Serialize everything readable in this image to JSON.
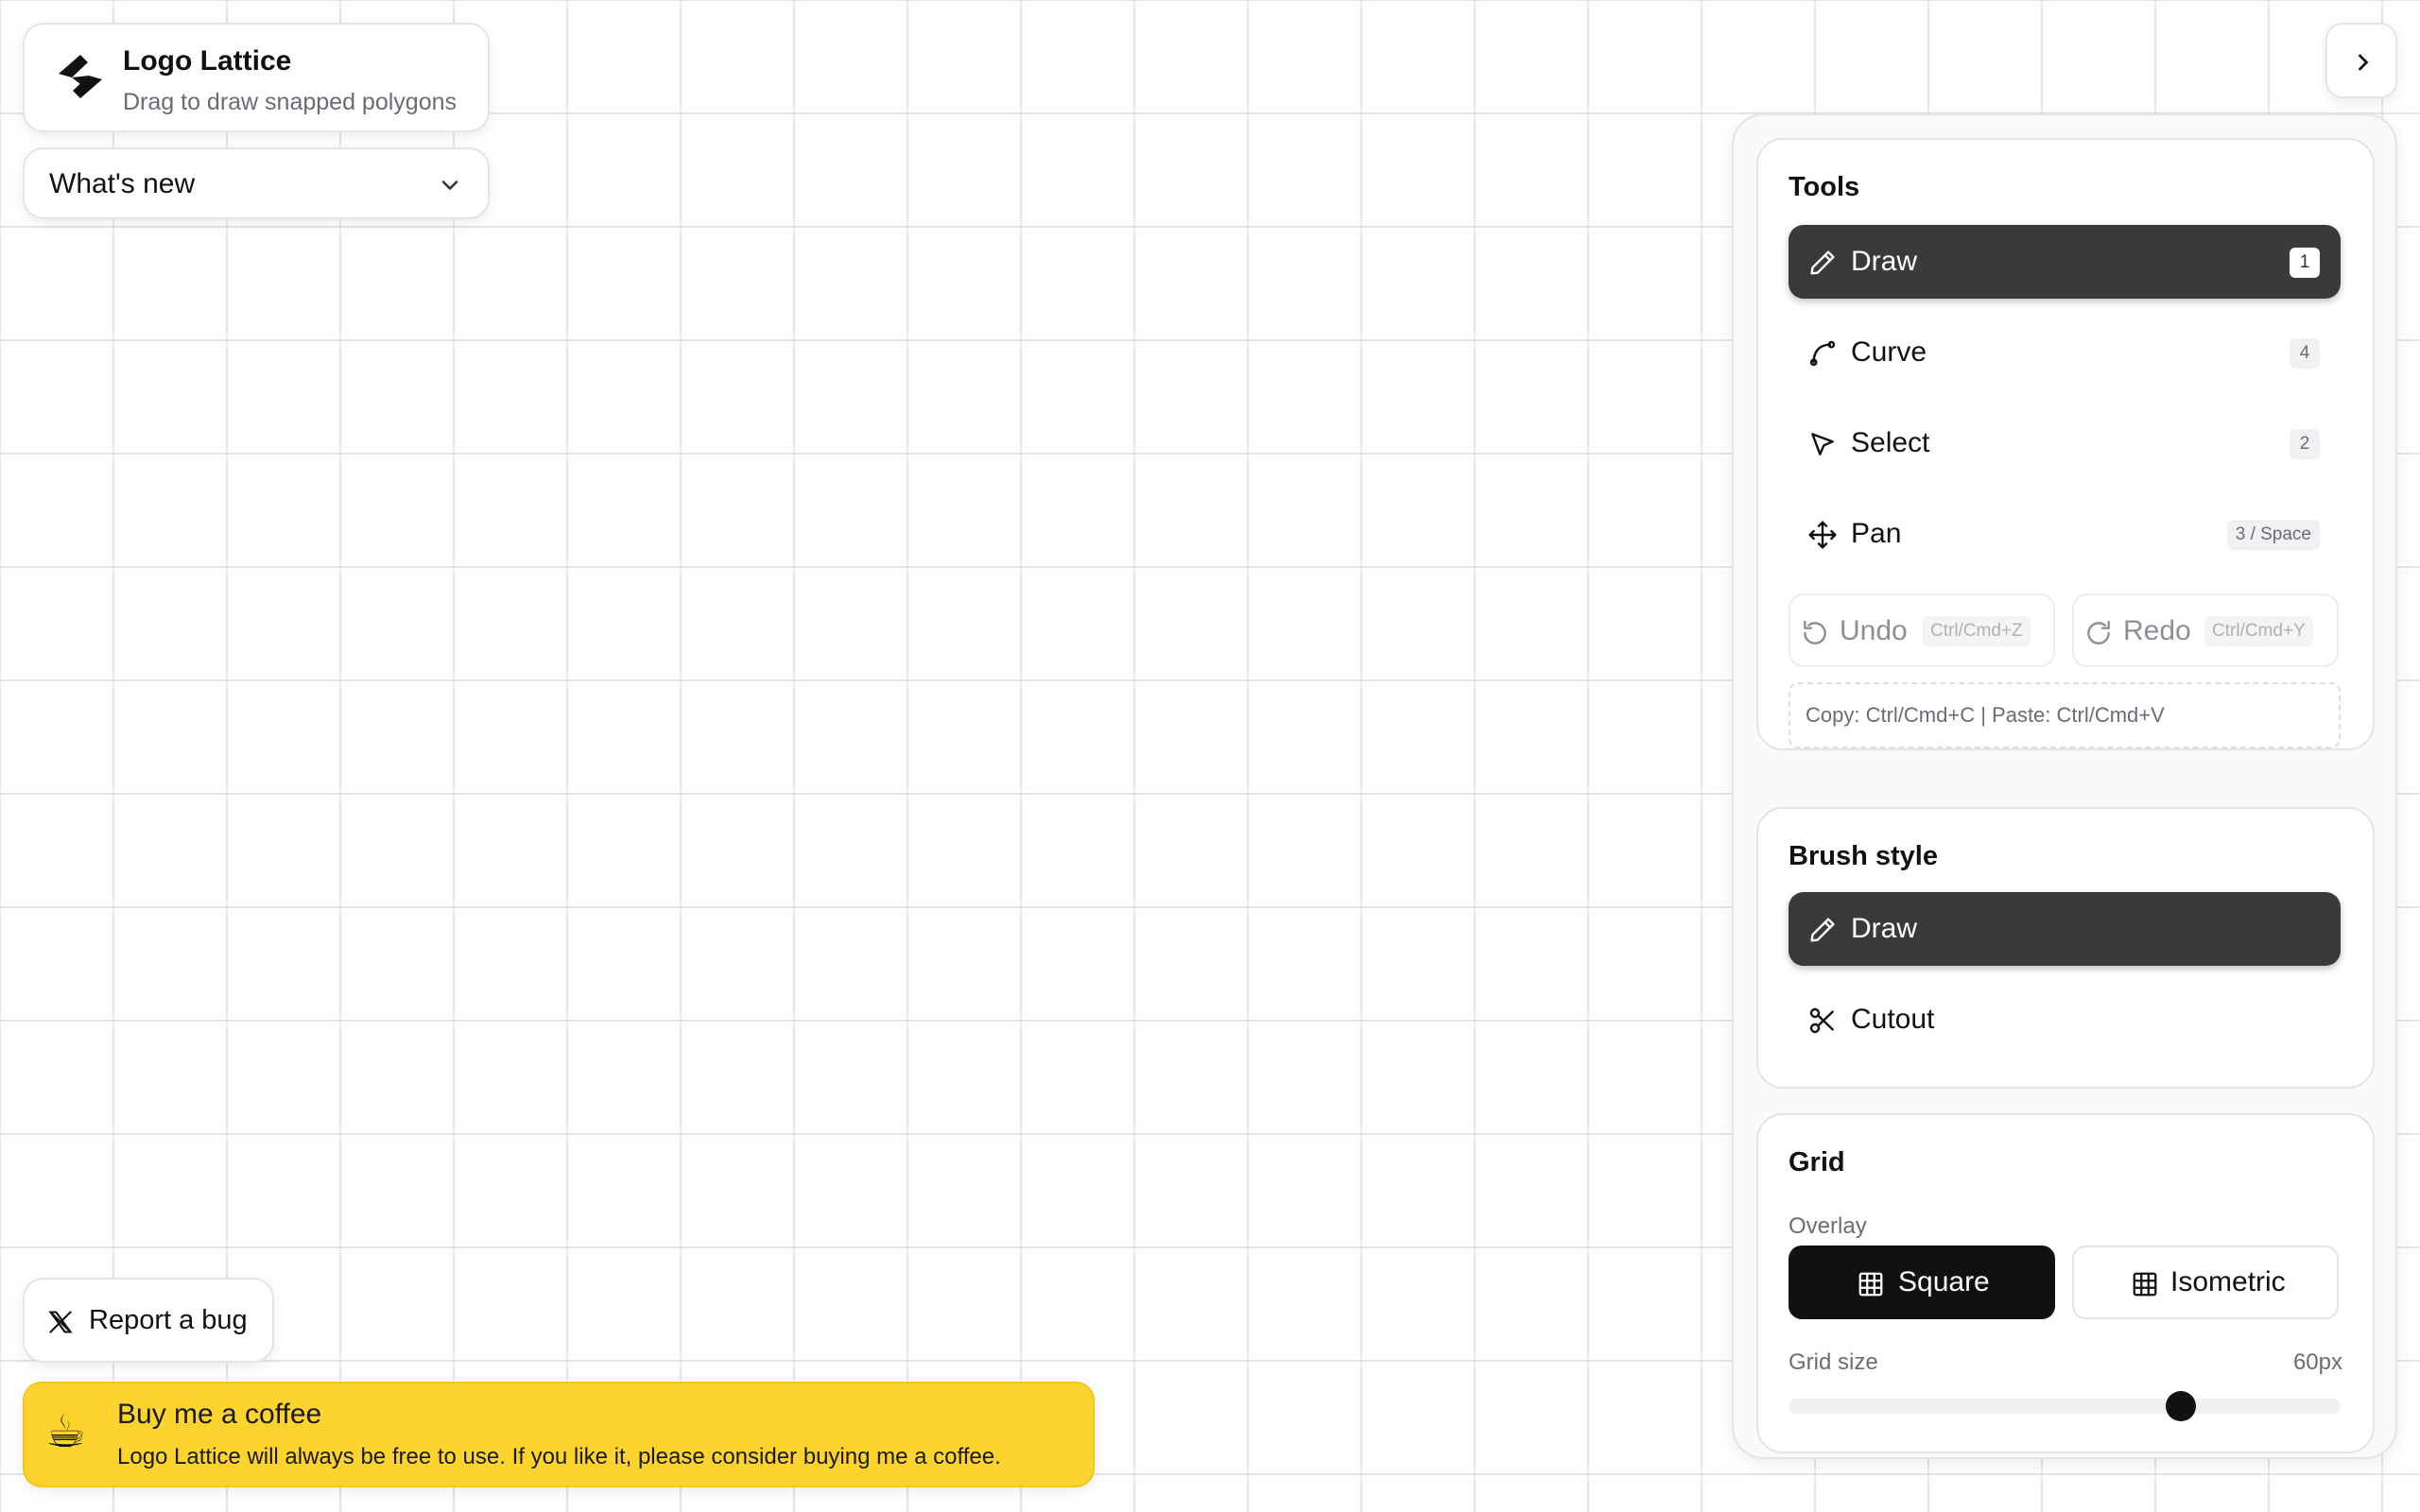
{
  "brand": {
    "title": "Logo Lattice",
    "subtitle": "Drag to draw snapped polygons"
  },
  "whats_new": {
    "label": "What's new"
  },
  "tools": {
    "title": "Tools",
    "items": [
      {
        "label": "Draw",
        "key": "1",
        "icon": "pencil-icon",
        "active": true
      },
      {
        "label": "Curve",
        "key": "4",
        "icon": "curve-icon",
        "active": false
      },
      {
        "label": "Select",
        "key": "2",
        "icon": "cursor-icon",
        "active": false
      },
      {
        "label": "Pan",
        "key": "3 / Space",
        "icon": "move-icon",
        "active": false
      }
    ],
    "undo": {
      "label": "Undo",
      "shortcut": "Ctrl/Cmd+Z"
    },
    "redo": {
      "label": "Redo",
      "shortcut": "Ctrl/Cmd+Y"
    },
    "copy_hint": "Copy: Ctrl/Cmd+C | Paste: Ctrl/Cmd+V"
  },
  "brush": {
    "title": "Brush style",
    "items": [
      {
        "label": "Draw",
        "icon": "pencil-icon",
        "active": true
      },
      {
        "label": "Cutout",
        "icon": "scissors-icon",
        "active": false
      }
    ]
  },
  "grid": {
    "title": "Grid",
    "overlay_label": "Overlay",
    "overlay_options": [
      {
        "label": "Square",
        "icon": "grid-icon",
        "active": true
      },
      {
        "label": "Isometric",
        "icon": "grid-icon",
        "active": false
      }
    ],
    "size_label": "Grid size",
    "size_value": "60px",
    "size_fraction": 0.71
  },
  "report_bug": {
    "label": "Report a bug",
    "icon": "x-logo-icon"
  },
  "coffee": {
    "emoji": "☕",
    "title": "Buy me a coffee",
    "text": "Logo Lattice will always be free to use. If you like it, please consider buying me a coffee."
  },
  "colors": {
    "accent": "#111111",
    "active_tool": "#3a3a3a",
    "coffee_bg": "#fdd32e",
    "grid_line": "#e6e6e6"
  }
}
